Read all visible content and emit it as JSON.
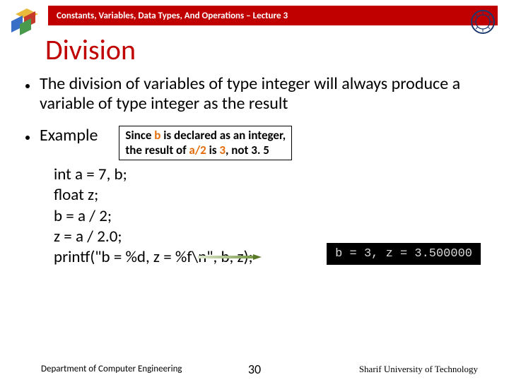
{
  "header": {
    "breadcrumb": "Constants, Variables, Data Types, And Operations – Lecture 3"
  },
  "title": "Division",
  "bullets": {
    "main": "The division of variables of type integer will always produce a variable of type integer as the result",
    "example_label": "Example"
  },
  "note": {
    "line1_pre": "Since ",
    "line1_b": "b",
    "line1_post": " is declared as an integer,",
    "line2_pre": "the result of ",
    "line2_frac": "a/2",
    "line2_mid": " is ",
    "line2_val": "3",
    "line2_post": ", not 3. 5"
  },
  "code": {
    "l1": "int a = 7, b;",
    "l2": "float z;",
    "l3": "b = a / 2;",
    "l4": "z = a / 2.0;",
    "l5": "printf(\"b = %d, z = %f\\n\", b, z);"
  },
  "output": "b = 3, z = 3.500000",
  "footer": {
    "left": "Department of Computer Engineering",
    "page": "30",
    "right": "Sharif University of Technology"
  }
}
